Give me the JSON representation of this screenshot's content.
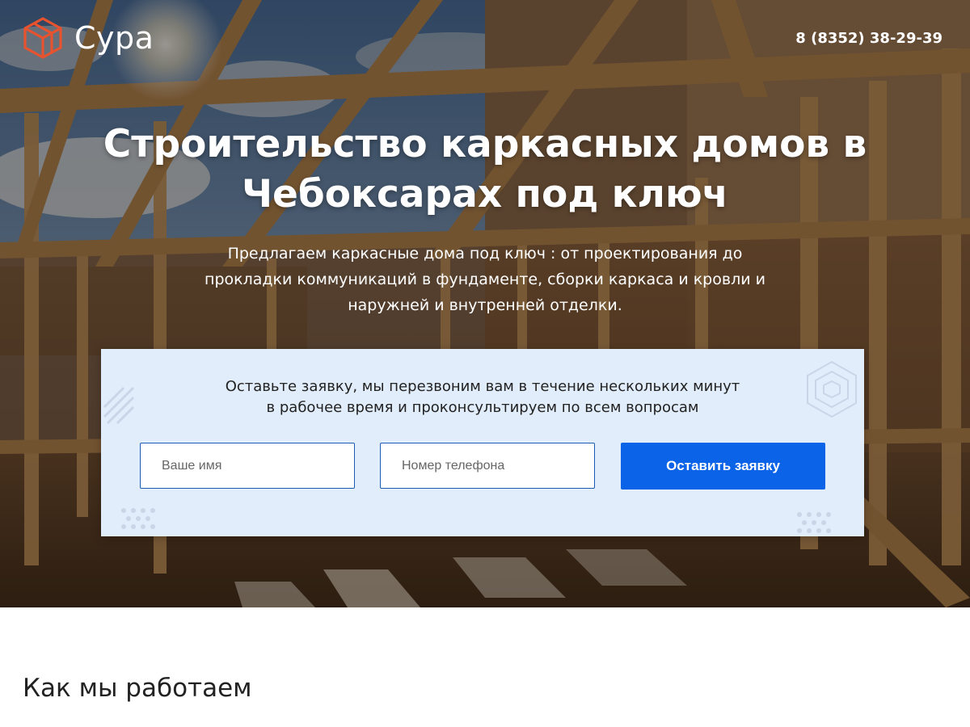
{
  "header": {
    "logo_text": "Сура",
    "phone": "8 (8352) 38-29-39"
  },
  "hero": {
    "title": "Строительство каркасных домов в Чебоксарах под ключ",
    "subtitle": "Предлагаем каркасные дома под ключ : от проектирования до прокладки коммуникаций в фундаменте, сборки каркаса и кровли и наружней и внутренней отделки."
  },
  "form": {
    "text_line1": "Оставьте заявку, мы перезвоним вам в течение нескольких минут",
    "text_line2": "в рабочее время и проконсультируем по всем вопросам",
    "name_placeholder": "Ваше имя",
    "phone_placeholder": "Номер телефона",
    "submit_label": "Оставить заявку"
  },
  "sections": {
    "how_we_work_title": "Как мы работаем"
  },
  "colors": {
    "accent_blue": "#0b63e8",
    "form_background": "#e1edfb",
    "logo_orange": "#e8532f"
  }
}
